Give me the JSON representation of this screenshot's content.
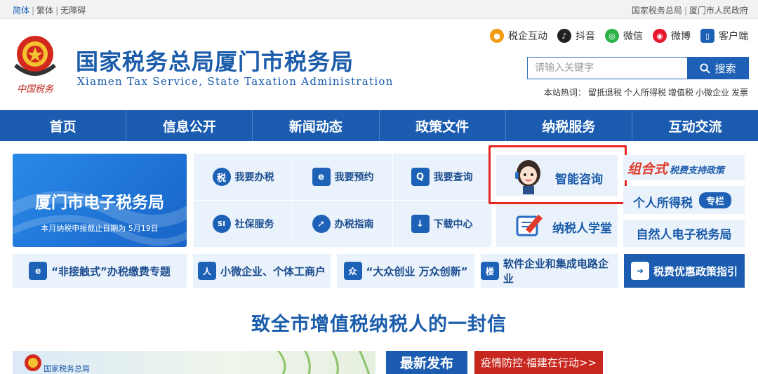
{
  "topbar": {
    "lang": [
      {
        "label": "简体",
        "active": true
      },
      {
        "label": "繁体",
        "active": false
      },
      {
        "label": "无障碍",
        "active": false
      }
    ],
    "links": [
      "国家税务总局",
      "厦门市人民政府"
    ]
  },
  "header": {
    "logo_text": "中国税务",
    "title": "国家税务总局厦门市税务局",
    "subtitle": "Xiamen Tax Service, State Taxation Administration"
  },
  "social": [
    {
      "label": "税企互动",
      "icon": "chat-bubble-icon",
      "color": "#f39c12"
    },
    {
      "label": "抖音",
      "icon": "tiktok-icon",
      "color": "#222222"
    },
    {
      "label": "微信",
      "icon": "wechat-icon",
      "color": "#2bb34a"
    },
    {
      "label": "微博",
      "icon": "weibo-icon",
      "color": "#e6162d"
    },
    {
      "label": "客户端",
      "icon": "mobile-app-icon",
      "color": "#1d60b5"
    }
  ],
  "search": {
    "placeholder": "请输入关键字",
    "button_label": "搜索"
  },
  "hot": {
    "label": "本站热词：",
    "items": [
      "留抵退税",
      "个人所得税",
      "增值税",
      "小微企业",
      "发票"
    ]
  },
  "nav": [
    "首页",
    "信息公开",
    "新闻动态",
    "政策文件",
    "纳税服务",
    "互动交流"
  ],
  "etax": {
    "title": "厦门市电子税务局",
    "notice": "本月纳税申报截止日期为 5月19日"
  },
  "services": [
    {
      "label": "我要办税",
      "glyph": "税"
    },
    {
      "label": "我要预约",
      "glyph": "e"
    },
    {
      "label": "我要查询",
      "glyph": "Q"
    },
    {
      "label": "社保服务",
      "glyph": "SI"
    },
    {
      "label": "办税指南",
      "glyph": "➚"
    },
    {
      "label": "下载中心",
      "glyph": "↓"
    }
  ],
  "smart": {
    "label": "智能咨询"
  },
  "learn": {
    "label": "纳税人学堂"
  },
  "side": {
    "combo_a": "组合式",
    "combo_b": "税费支持政策",
    "iit_a": "个人所得税",
    "iit_b": "专栏",
    "nep": "自然人电子税务局"
  },
  "row2": [
    {
      "label": "“非接触式”办税缴费专题",
      "glyph": "e"
    },
    {
      "label": "小微企业、个体工商户",
      "glyph": "人"
    },
    {
      "label": "“大众创业 万众创新”",
      "glyph": "众"
    },
    {
      "label": "软件企业和集成电路企业",
      "glyph": "楼"
    },
    {
      "label": "税费优惠政策指引",
      "glyph": "➜"
    }
  ],
  "letter": {
    "title": "致全市增值税纳税人的一封信"
  },
  "bottom": {
    "banner_label": "国家税务总局",
    "news_tab": "最新发布",
    "covid": "疫情防控·福建在行动>>"
  }
}
